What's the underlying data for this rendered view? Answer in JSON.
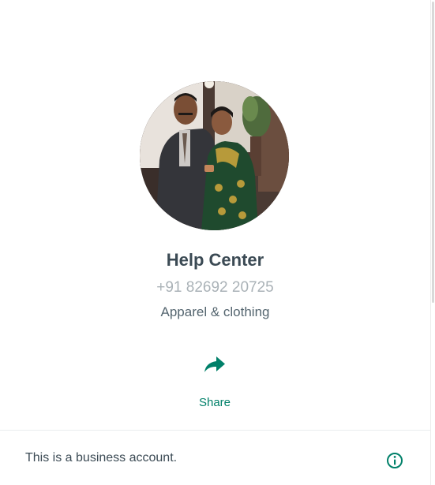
{
  "profile": {
    "name": "Help Center",
    "phone": "+91 82692 20725",
    "category": "Apparel & clothing",
    "avatar_icon": "profile-photo"
  },
  "actions": {
    "share_label": "Share",
    "share_icon": "share-arrow-icon"
  },
  "business": {
    "notice": "This is a business account.",
    "info_icon": "info-icon"
  },
  "colors": {
    "accent": "#008069",
    "title": "#3b4a54",
    "secondary": "#54656f",
    "muted": "#aab2b7",
    "divider": "#e9edef"
  }
}
